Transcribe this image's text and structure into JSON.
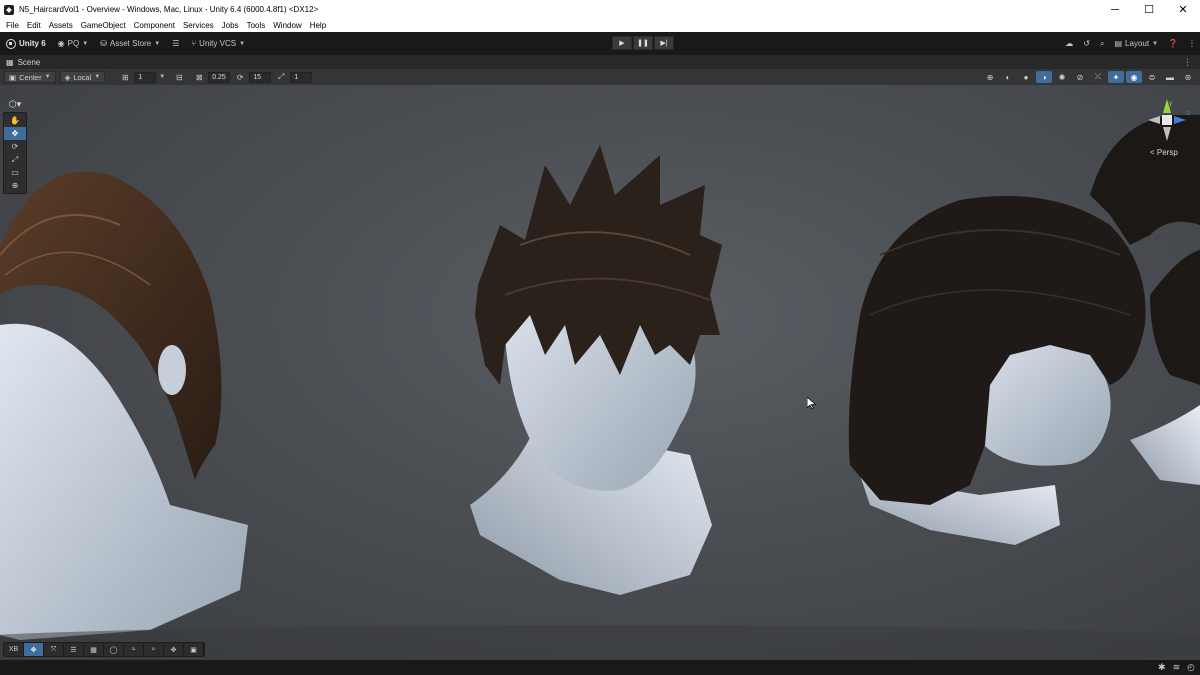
{
  "window": {
    "title": "N5_HaircardVol1 - Overview - Windows, Mac, Linux - Unity 6.4 (6000.4.8f1) <DX12>",
    "controls": [
      "─",
      "☐",
      "✕"
    ]
  },
  "menu": [
    "File",
    "Edit",
    "Assets",
    "GameObject",
    "Component",
    "Services",
    "Jobs",
    "Tools",
    "Window",
    "Help"
  ],
  "toolbar": {
    "unity_label": "Unity 6",
    "account_label": "PQ",
    "asset_store_label": "Asset Store",
    "vcs_label": "Unity VCS",
    "layout_label": "Layout"
  },
  "scene_tab": {
    "label": "Scene"
  },
  "scene_toolbar": {
    "pivot_label": "Center",
    "space_label": "Local",
    "grid_value": "1",
    "snap_increment": "0.25",
    "rotate_snap": "15",
    "scale_snap": "1"
  },
  "gizmo": {
    "projection_label": "Persp",
    "axis_y": "y",
    "axis_z": "z"
  },
  "overlay_bar": {
    "items": [
      "XB",
      "✥",
      "⤧",
      "☰",
      "▦",
      "◯",
      "≈",
      "⌕",
      "✥",
      "▣"
    ]
  },
  "colors": {
    "accent": "#3f6d9c",
    "viewport_bg": "#4a4d52",
    "chrome_dark": "#191919"
  }
}
